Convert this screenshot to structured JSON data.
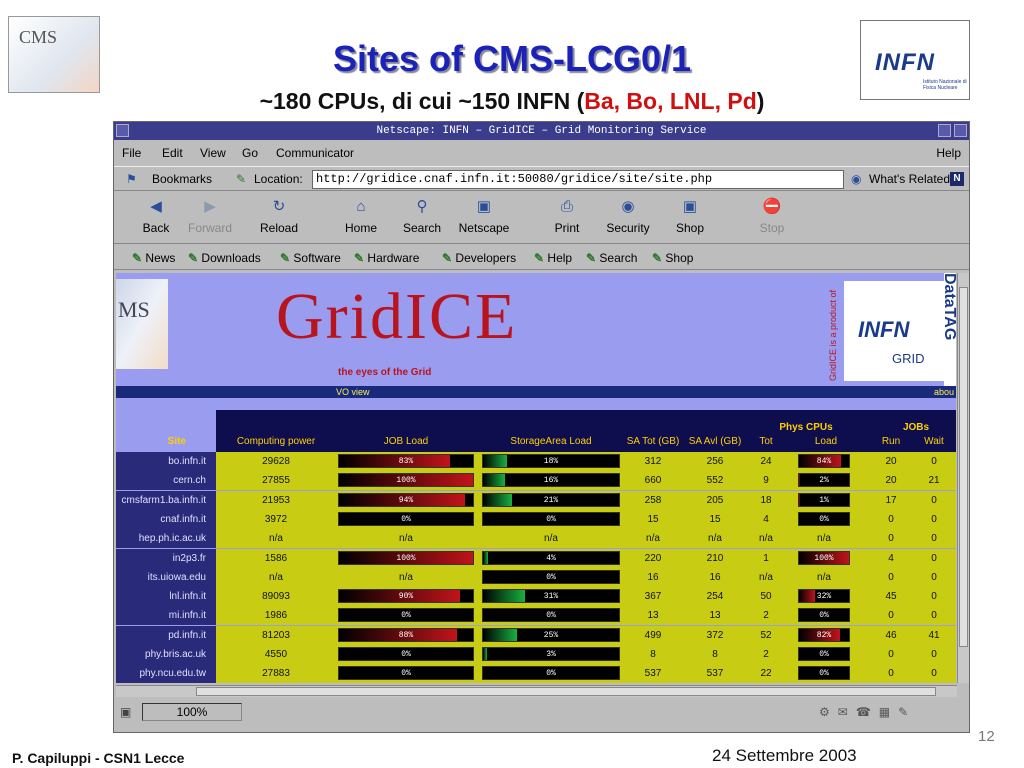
{
  "slide": {
    "title": "Sites of CMS-LCG0/1",
    "subtitle_pre": "~180 CPUs, di cui ~150 INFN (",
    "subtitle_red": "Ba, Bo, LNL, Pd",
    "subtitle_post": ")",
    "footer_left": "P. Capiluppi - CSN1 Lecce",
    "footer_date": "24 Settembre 2003",
    "page_number": "12",
    "cms_logo_text": "CMS",
    "infn_logo_text": "INFN",
    "infn_logo_sub": "Istituto Nazionale di Fisica Nucleare"
  },
  "browser": {
    "window_title": "Netscape: INFN – GridICE – Grid Monitoring Service",
    "menu": [
      "File",
      "Edit",
      "View",
      "Go",
      "Communicator"
    ],
    "menu_help": "Help",
    "bookmarks_label": "Bookmarks",
    "location_label": "Location:",
    "url": "http://gridice.cnaf.infn.it:50080/gridice/site/site.php",
    "whats_related": "What's Related",
    "nav": [
      {
        "label": "Back",
        "icon": "back-arrow-icon",
        "enabled": true
      },
      {
        "label": "Forward",
        "icon": "forward-arrow-icon",
        "enabled": false
      },
      {
        "label": "Reload",
        "icon": "reload-icon",
        "enabled": true
      },
      {
        "label": "Home",
        "icon": "home-icon",
        "enabled": true
      },
      {
        "label": "Search",
        "icon": "search-icon",
        "enabled": true
      },
      {
        "label": "Netscape",
        "icon": "netscape-icon",
        "enabled": true
      },
      {
        "label": "Print",
        "icon": "print-icon",
        "enabled": true
      },
      {
        "label": "Security",
        "icon": "security-lock-icon",
        "enabled": true
      },
      {
        "label": "Shop",
        "icon": "shop-icon",
        "enabled": true
      },
      {
        "label": "Stop",
        "icon": "stop-icon",
        "enabled": false
      }
    ],
    "personal": [
      "News",
      "Downloads",
      "Software",
      "Hardware",
      "Developers",
      "Help",
      "Search",
      "Shop"
    ],
    "status_percent": "100%"
  },
  "page": {
    "logo_text": "GridICE",
    "tagline": "the eyes of the Grid",
    "product_of": "GridICE is a product of",
    "vo_view": "VO view",
    "about": "abou",
    "partner_infn": "INFN",
    "partner_grid": "GRID",
    "partner_datatag": "DataTAG",
    "cms_banner_text": "MS",
    "table": {
      "headers": {
        "site": "Site",
        "computing_power": "Computing power",
        "job_load": "JOB Load",
        "storage_load": "StorageArea Load",
        "sa_tot": "SA Tot (GB)",
        "sa_avl": "SA Avl (GB)",
        "phys_cpus": "Phys CPUs",
        "tot": "Tot",
        "load": "Load",
        "jobs": "JOBs",
        "run": "Run",
        "wait": "Wait"
      },
      "rows": [
        {
          "site": "bo.infn.it",
          "cp": "29628",
          "job": "83%",
          "job_v": 83,
          "sa": "18%",
          "sa_v": 18,
          "sa_tot": "312",
          "sa_avl": "256",
          "tot": "24",
          "load": "84%",
          "load_v": 84,
          "run": "20",
          "wait": "0"
        },
        {
          "site": "cern.ch",
          "cp": "27855",
          "job": "100%",
          "job_v": 100,
          "sa": "16%",
          "sa_v": 16,
          "sa_tot": "660",
          "sa_avl": "552",
          "tot": "9",
          "load": "2%",
          "load_v": 2,
          "run": "20",
          "wait": "21"
        },
        {
          "site": "cmsfarm1.ba.infn.it",
          "cp": "21953",
          "job": "94%",
          "job_v": 94,
          "sa": "21%",
          "sa_v": 21,
          "sa_tot": "258",
          "sa_avl": "205",
          "tot": "18",
          "load": "1%",
          "load_v": 1,
          "run": "17",
          "wait": "0"
        },
        {
          "site": "cnaf.infn.it",
          "cp": "3972",
          "job": "0%",
          "job_v": 0,
          "sa": "0%",
          "sa_v": 0,
          "sa_tot": "15",
          "sa_avl": "15",
          "tot": "4",
          "load": "0%",
          "load_v": 0,
          "run": "0",
          "wait": "0"
        },
        {
          "site": "hep.ph.ic.ac.uk",
          "cp": "n/a",
          "job": "n/a",
          "job_v": null,
          "sa": "n/a",
          "sa_v": null,
          "sa_tot": "n/a",
          "sa_avl": "n/a",
          "tot": "n/a",
          "load": "n/a",
          "load_v": null,
          "run": "0",
          "wait": "0"
        },
        {
          "site": "in2p3.fr",
          "cp": "1586",
          "job": "100%",
          "job_v": 100,
          "sa": "4%",
          "sa_v": 4,
          "sa_tot": "220",
          "sa_avl": "210",
          "tot": "1",
          "load": "100%",
          "load_v": 100,
          "run": "4",
          "wait": "0"
        },
        {
          "site": "its.uiowa.edu",
          "cp": "n/a",
          "job": "n/a",
          "job_v": null,
          "sa": "0%",
          "sa_v": 0,
          "sa_tot": "16",
          "sa_avl": "16",
          "tot": "n/a",
          "load": "n/a",
          "load_v": null,
          "run": "0",
          "wait": "0"
        },
        {
          "site": "lnl.infn.it",
          "cp": "89093",
          "job": "90%",
          "job_v": 90,
          "sa": "31%",
          "sa_v": 31,
          "sa_tot": "367",
          "sa_avl": "254",
          "tot": "50",
          "load": "32%",
          "load_v": 32,
          "run": "45",
          "wait": "0"
        },
        {
          "site": "mi.infn.it",
          "cp": "1986",
          "job": "0%",
          "job_v": 0,
          "sa": "0%",
          "sa_v": 0,
          "sa_tot": "13",
          "sa_avl": "13",
          "tot": "2",
          "load": "0%",
          "load_v": 0,
          "run": "0",
          "wait": "0"
        },
        {
          "site": "pd.infn.it",
          "cp": "81203",
          "job": "88%",
          "job_v": 88,
          "sa": "25%",
          "sa_v": 25,
          "sa_tot": "499",
          "sa_avl": "372",
          "tot": "52",
          "load": "82%",
          "load_v": 82,
          "run": "46",
          "wait": "41"
        },
        {
          "site": "phy.bris.ac.uk",
          "cp": "4550",
          "job": "0%",
          "job_v": 0,
          "sa": "3%",
          "sa_v": 3,
          "sa_tot": "8",
          "sa_avl": "8",
          "tot": "2",
          "load": "0%",
          "load_v": 0,
          "run": "0",
          "wait": "0"
        },
        {
          "site": "phy.ncu.edu.tw",
          "cp": "27883",
          "job": "0%",
          "job_v": 0,
          "sa": "0%",
          "sa_v": 0,
          "sa_tot": "537",
          "sa_avl": "537",
          "tot": "22",
          "load": "0%",
          "load_v": 0,
          "run": "0",
          "wait": "0"
        }
      ]
    }
  },
  "colors": {
    "title_blue": "#1a22b8",
    "subtitle_red": "#d01010",
    "row_bg": "#c8cc12",
    "site_bg": "#2a2a7a",
    "job_bar": "#c0141a",
    "storage_bar": "#18b040",
    "load_bar": "#c0141a"
  }
}
